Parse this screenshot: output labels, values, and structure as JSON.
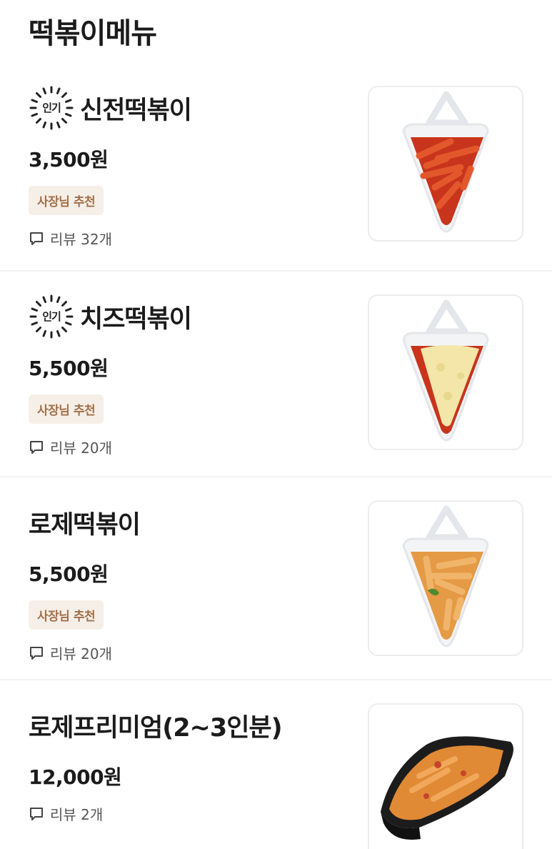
{
  "section": {
    "title": "떡볶이메뉴"
  },
  "popular_label": "인기",
  "items": [
    {
      "name": "신전떡볶이",
      "price": "3,500원",
      "popular": true,
      "recommend": "사장님 추천",
      "review": "리뷰 32개",
      "image": "red-tteokbokki"
    },
    {
      "name": "치즈떡볶이",
      "price": "5,500원",
      "popular": true,
      "recommend": "사장님 추천",
      "review": "리뷰 20개",
      "image": "cheese-tteokbokki"
    },
    {
      "name": "로제떡볶이",
      "price": "5,500원",
      "popular": false,
      "recommend": "사장님 추천",
      "review": "리뷰 20개",
      "image": "rose-tteokbokki"
    },
    {
      "name": "로제프리미엄(2~3인분)",
      "price": "12,000원",
      "popular": false,
      "review": "리뷰 2개",
      "image": "rose-premium-tray"
    }
  ],
  "colors": {
    "red_sauce": "#c8341c",
    "cheese": "#f3e6a8",
    "rose_sauce": "#e59a45",
    "badge_bg": "#f6efe7",
    "badge_text": "#a1704a"
  }
}
